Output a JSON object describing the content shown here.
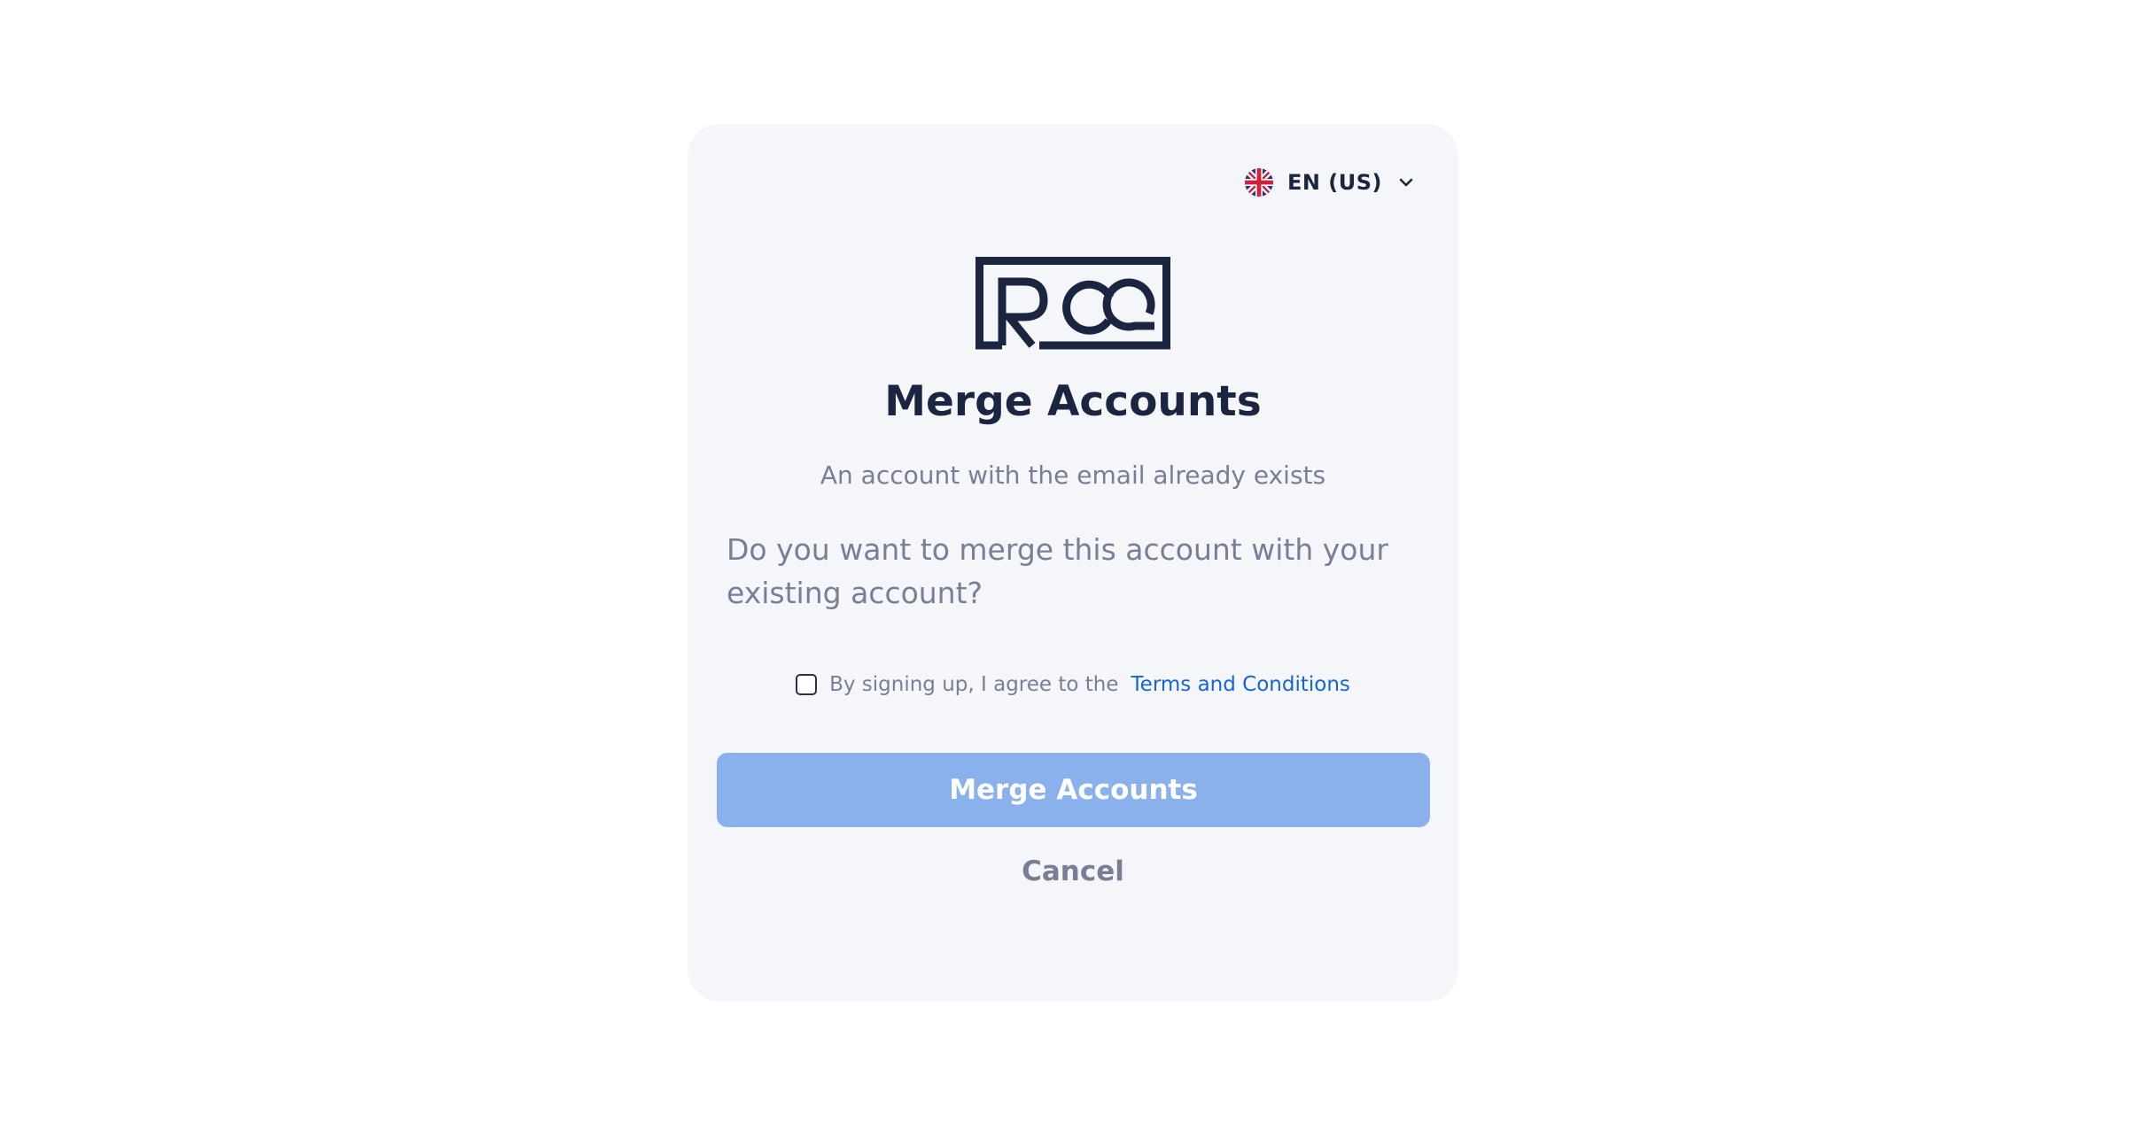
{
  "language": {
    "label": "EN (US)",
    "flag_icon": "uk-flag-icon",
    "dropdown_icon": "chevron-down-icon"
  },
  "logo": {
    "text": "ROQ",
    "color": "#1b2540"
  },
  "title": "Merge Accounts",
  "subtitle": "An account with the email already exists",
  "question": "Do you want to merge this account with your existing account?",
  "agreement": {
    "checked": false,
    "text": "By signing up, I agree to the",
    "link_label": "Terms and Conditions",
    "link_color": "#1565d8"
  },
  "merge_button": {
    "label": "Merge Accounts",
    "color": "#8ab1eb"
  },
  "cancel_label": "Cancel"
}
